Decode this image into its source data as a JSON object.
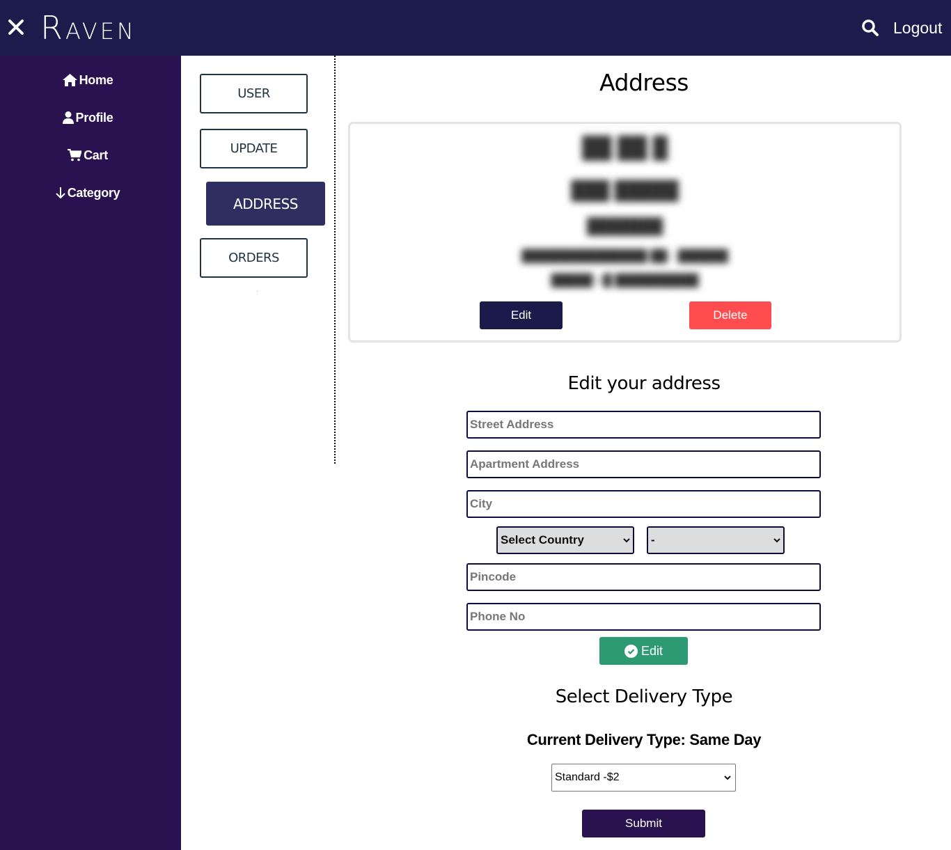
{
  "header": {
    "brand": "Raven",
    "logout_label": "Logout",
    "colors": {
      "background": "#1d1b4c",
      "text": "#ffffff"
    }
  },
  "sidebar": {
    "items": [
      {
        "label": "Home",
        "icon": "home-icon"
      },
      {
        "label": "Profile",
        "icon": "user-icon"
      },
      {
        "label": "Cart",
        "icon": "cart-icon"
      },
      {
        "label": "Category",
        "icon": "arrow-down-icon"
      }
    ],
    "colors": {
      "background": "#2a1150"
    }
  },
  "account_tabs": {
    "items": [
      {
        "label": "USER",
        "active": false
      },
      {
        "label": "UPDATE",
        "active": false
      },
      {
        "label": "ADDRESS",
        "active": true
      },
      {
        "label": "ORDERS",
        "active": false
      }
    ],
    "colors": {
      "active_bg": "#2f2e61",
      "border": "#1e3440"
    }
  },
  "main": {
    "title": "Address",
    "address_card": {
      "lines_redacted": [
        "██ ██ █",
        "███ █████",
        "███████",
        "███████████████ ██ - ██████",
        "█████ +█ ██████████"
      ],
      "edit_label": "Edit",
      "delete_label": "Delete",
      "colors": {
        "edit_bg": "#1b1a4b",
        "delete_bg": "#ff4d4f"
      }
    },
    "edit_form": {
      "title": "Edit your address",
      "fields": {
        "street": {
          "placeholder": "Street Address",
          "value": ""
        },
        "apartment": {
          "placeholder": "Apartment Address",
          "value": ""
        },
        "city": {
          "placeholder": "City",
          "value": ""
        },
        "pincode": {
          "placeholder": "Pincode",
          "value": ""
        },
        "phone": {
          "placeholder": "Phone No",
          "value": ""
        }
      },
      "country_select": {
        "selected": "Select Country"
      },
      "state_select": {
        "selected": "-"
      },
      "submit_label": "Edit",
      "colors": {
        "submit_bg": "#2e9a74",
        "field_border": "#0d0c3f"
      }
    },
    "delivery": {
      "title": "Select Delivery Type",
      "current_label": "Current Delivery Type: Same Day",
      "select": {
        "selected": "Standard -$2"
      },
      "submit_label": "Submit",
      "colors": {
        "submit_bg": "#2a1150"
      }
    }
  }
}
